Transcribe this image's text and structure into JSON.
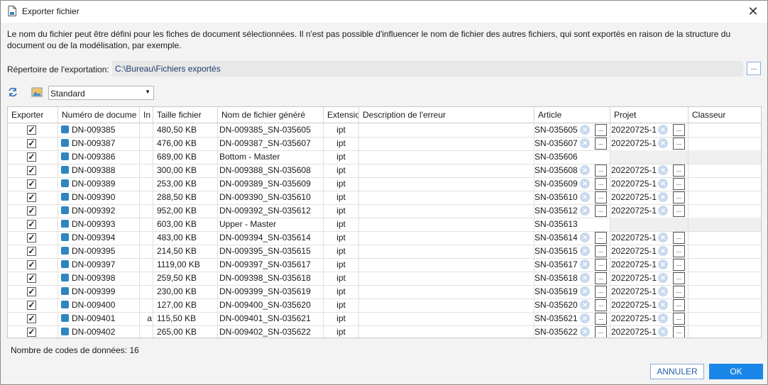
{
  "window": {
    "title": "Exporter fichier"
  },
  "description": "Le nom du fichier peut être défini pour les fiches de document sélectionnées. Il n'est pas possible d'influencer le nom de fichier des autres fichiers, qui sont exportés en raison de la structure du document ou de la modélisation, par exemple.",
  "export_dir": {
    "label": "Répertoire de l'exportation:",
    "value": "C:\\Bureau\\Fichiers exportés",
    "browse_label": "..."
  },
  "toolbar": {
    "view_select": "Standard"
  },
  "columns": [
    "Exporter",
    "Numéro de docume",
    "In",
    "Taille fichier",
    "Nom de fichier généré",
    "Extensio",
    "Description de l'erreur",
    "Article",
    "Projet",
    "Classeur"
  ],
  "rows": [
    {
      "doc": "DN-009385",
      "in": "",
      "size": "480,50 KB",
      "name": "DN-009385_SN-035605",
      "ext": "ipt",
      "article": "SN-035605",
      "project": "20220725-1"
    },
    {
      "doc": "DN-009387",
      "in": "",
      "size": "476,00 KB",
      "name": "DN-009387_SN-035607",
      "ext": "ipt",
      "article": "SN-035607",
      "project": "20220725-1"
    },
    {
      "doc": "DN-009386",
      "in": "",
      "size": "689,00 KB",
      "name": "Bottom - Master",
      "ext": "ipt",
      "article": "SN-035606",
      "project": ""
    },
    {
      "doc": "DN-009388",
      "in": "",
      "size": "300,00 KB",
      "name": "DN-009388_SN-035608",
      "ext": "ipt",
      "article": "SN-035608",
      "project": "20220725-1"
    },
    {
      "doc": "DN-009389",
      "in": "",
      "size": "253,00 KB",
      "name": "DN-009389_SN-035609",
      "ext": "ipt",
      "article": "SN-035609",
      "project": "20220725-1"
    },
    {
      "doc": "DN-009390",
      "in": "",
      "size": "288,50 KB",
      "name": "DN-009390_SN-035610",
      "ext": "ipt",
      "article": "SN-035610",
      "project": "20220725-1"
    },
    {
      "doc": "DN-009392",
      "in": "",
      "size": "952,00 KB",
      "name": "DN-009392_SN-035612",
      "ext": "ipt",
      "article": "SN-035612",
      "project": "20220725-1"
    },
    {
      "doc": "DN-009393",
      "in": "",
      "size": "603,00 KB",
      "name": "Upper - Master",
      "ext": "ipt",
      "article": "SN-035613",
      "project": ""
    },
    {
      "doc": "DN-009394",
      "in": "",
      "size": "483,00 KB",
      "name": "DN-009394_SN-035614",
      "ext": "ipt",
      "article": "SN-035614",
      "project": "20220725-1"
    },
    {
      "doc": "DN-009395",
      "in": "",
      "size": "214,50 KB",
      "name": "DN-009395_SN-035615",
      "ext": "ipt",
      "article": "SN-035615",
      "project": "20220725-1"
    },
    {
      "doc": "DN-009397",
      "in": "",
      "size": "1119,00 KB",
      "name": "DN-009397_SN-035617",
      "ext": "ipt",
      "article": "SN-035617",
      "project": "20220725-1"
    },
    {
      "doc": "DN-009398",
      "in": "",
      "size": "259,50 KB",
      "name": "DN-009398_SN-035618",
      "ext": "ipt",
      "article": "SN-035618",
      "project": "20220725-1"
    },
    {
      "doc": "DN-009399",
      "in": "",
      "size": "230,00 KB",
      "name": "DN-009399_SN-035619",
      "ext": "ipt",
      "article": "SN-035619",
      "project": "20220725-1"
    },
    {
      "doc": "DN-009400",
      "in": "",
      "size": "127,00 KB",
      "name": "DN-009400_SN-035620",
      "ext": "ipt",
      "article": "SN-035620",
      "project": "20220725-1"
    },
    {
      "doc": "DN-009401",
      "in": "a",
      "size": "115,50 KB",
      "name": "DN-009401_SN-035621",
      "ext": "ipt",
      "article": "SN-035621",
      "project": "20220725-1"
    },
    {
      "doc": "DN-009402",
      "in": "",
      "size": "265,00 KB",
      "name": "DN-009402_SN-035622",
      "ext": "ipt",
      "article": "SN-035622",
      "project": "20220725-1"
    }
  ],
  "footer": {
    "count_label": "Nombre de codes de données: 16"
  },
  "buttons": {
    "cancel": "ANNULER",
    "ok": "OK"
  },
  "colors": {
    "accent": "#1a86e8",
    "path_text": "#1f3d6b"
  }
}
